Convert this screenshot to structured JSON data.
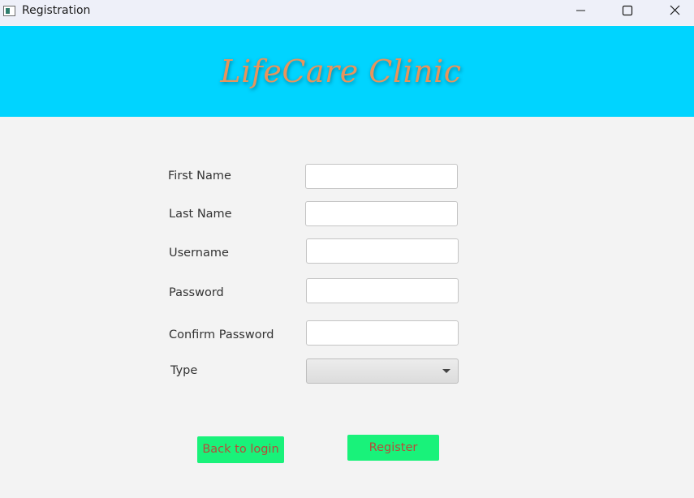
{
  "window": {
    "title": "Registration",
    "controls": [
      "minimize-icon",
      "maximize-icon",
      "close-icon"
    ]
  },
  "banner": {
    "title": "LifeCare Clinic",
    "background": "#00d4ff",
    "title_color": "#e8945c"
  },
  "form": {
    "first_name": {
      "label": "First Name",
      "value": ""
    },
    "last_name": {
      "label": "Last Name",
      "value": ""
    },
    "username": {
      "label": "Username",
      "value": ""
    },
    "password": {
      "label": "Password",
      "value": ""
    },
    "confirm_password": {
      "label": "Confirm Password",
      "value": ""
    },
    "type": {
      "label": "Type",
      "selected": ""
    }
  },
  "buttons": {
    "back": "Back to login",
    "register": "Register",
    "color": "#19f27a",
    "text_color": "#b84a3a"
  }
}
